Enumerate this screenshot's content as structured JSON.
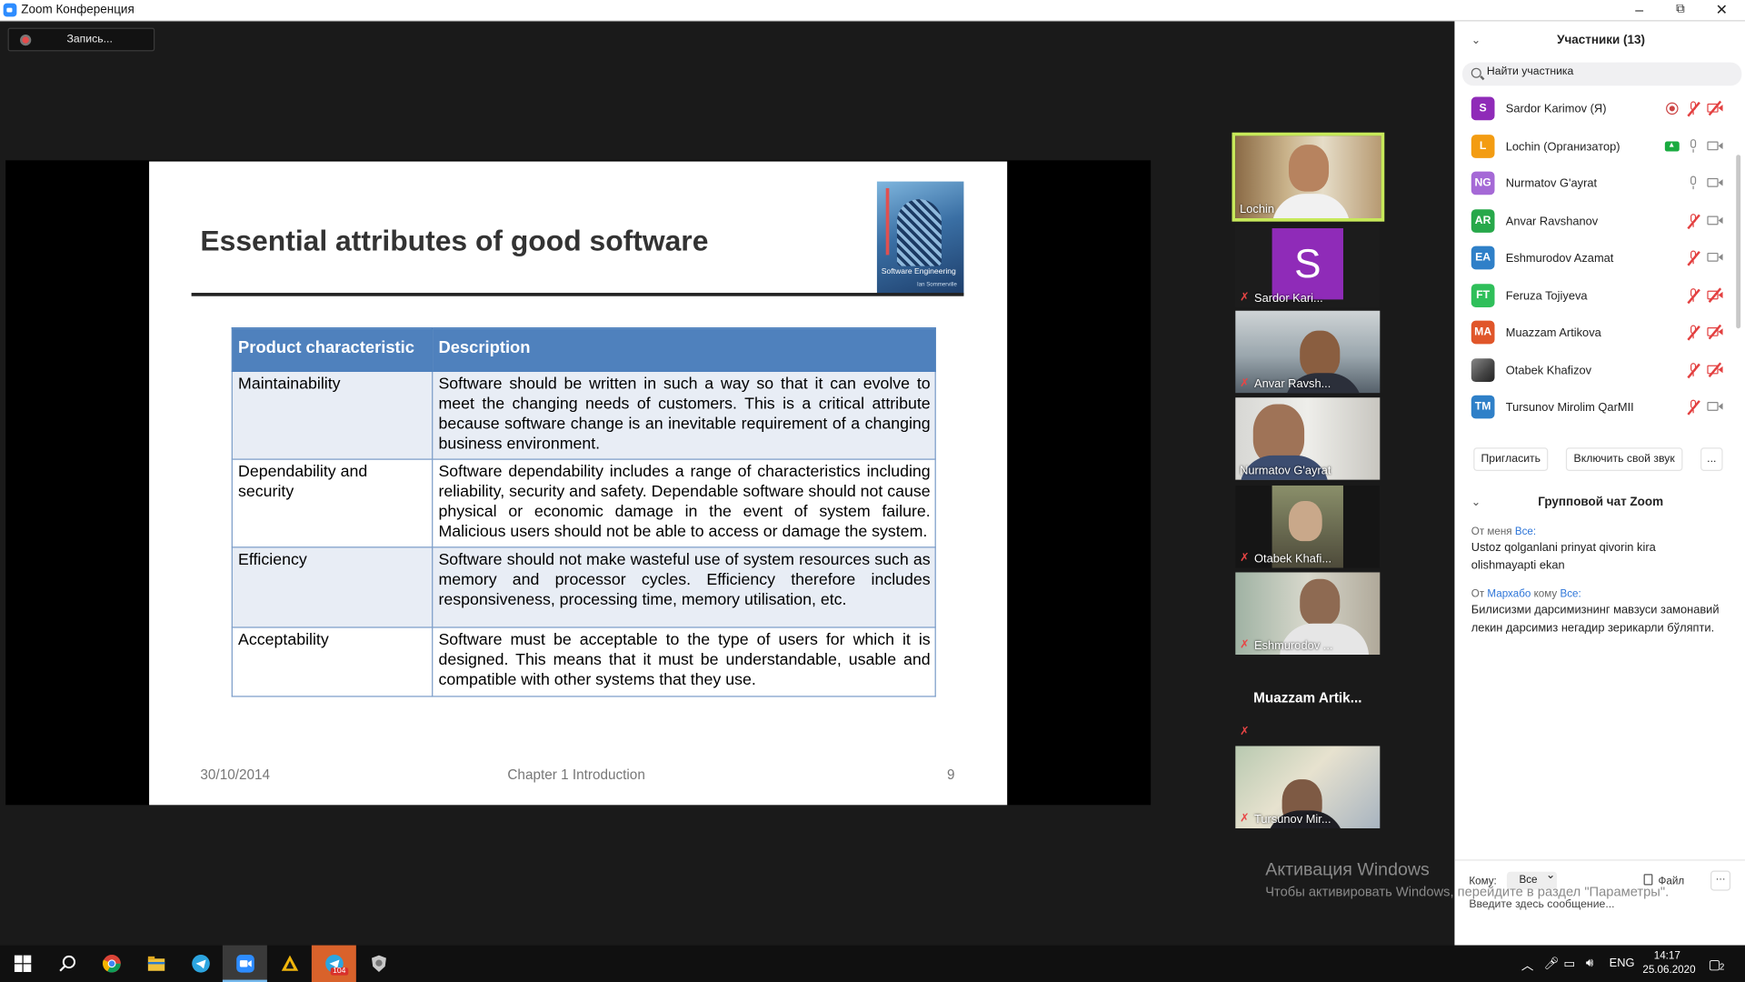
{
  "window": {
    "title": "Zoom Конференция",
    "controls": {
      "minimize": "–",
      "restore": "⧉",
      "close": "✕"
    }
  },
  "recording": {
    "label": "Запись..."
  },
  "slide": {
    "title": "Essential attributes of good software",
    "book": {
      "title": "Software Engineering",
      "author": "Ian Sommerville"
    },
    "table": {
      "headers": [
        "Product characteristic",
        "Description"
      ],
      "rows": [
        {
          "characteristic": "Maintainability",
          "description": "Software should be written in such a way so that it can evolve to meet the changing needs of customers. This is a critical attribute because software change is an inevitable requirement of a changing business environment."
        },
        {
          "characteristic": "Dependability and security",
          "description": "Software dependability includes a range of characteristics including reliability, security and safety. Dependable software should not cause physical or economic damage in the event of system failure. Malicious users should not be  able to access or damage the system."
        },
        {
          "characteristic": "Efficiency",
          "description": "Software should not make wasteful use of system resources such as memory and processor cycles. Efficiency therefore includes responsiveness, processing time, memory utilisation, etc."
        },
        {
          "characteristic": "Acceptability",
          "description": "Software must be acceptable to the type of users for which it is designed. This means that it must be understandable, usable and compatible with other systems that they use."
        }
      ]
    },
    "footer": {
      "date": "30/10/2014",
      "chapter": "Chapter 1 Introduction",
      "page": "9"
    }
  },
  "gallery": [
    {
      "name": "Lochin"
    },
    {
      "name": "Sardor Kari...",
      "initial": "S"
    },
    {
      "name": "Anvar Ravsh..."
    },
    {
      "name": "Nurmatov G'ayrat"
    },
    {
      "name": "Otabek Khafi..."
    },
    {
      "name": "Eshmurodov ..."
    },
    {
      "name": "Muazzam  Artik..."
    },
    {
      "name": "Tursunov Mir..."
    }
  ],
  "watermark": {
    "line1": "Активация Windows",
    "line2": "Чтобы активировать Windows, перейдите в раздел \"Параметры\"."
  },
  "participants": {
    "header": "Участники (13)",
    "search_placeholder": "Найти участника",
    "list": [
      {
        "initials": "S",
        "name": "Sardor Karimov (Я)",
        "color": "#8f2bb8"
      },
      {
        "initials": "L",
        "name": "Lochin (Организатор)",
        "color": "#f39c12"
      },
      {
        "initials": "NG",
        "name": "Nurmatov G'ayrat",
        "color": "#a569d6"
      },
      {
        "initials": "AR",
        "name": "Anvar Ravshanov",
        "color": "#27a84a"
      },
      {
        "initials": "EA",
        "name": "Eshmurodov Azamat",
        "color": "#2f80c8"
      },
      {
        "initials": "FT",
        "name": "Feruza Tojiyeva",
        "color": "#2fbf5a"
      },
      {
        "initials": "MA",
        "name": "Muazzam Artikova",
        "color": "#e0562a"
      },
      {
        "initials": "",
        "name": "Otabek Khafizov",
        "color": "#555555"
      },
      {
        "initials": "TM",
        "name": "Tursunov Mirolim QarMII",
        "color": "#2f80c8"
      }
    ],
    "buttons": {
      "invite": "Пригласить",
      "unmute": "Включить свой звук",
      "more": "..."
    }
  },
  "chat": {
    "header": "Групповой чат Zoom",
    "messages": [
      {
        "meta_prefix": "От меня ",
        "meta_to": "Все:",
        "sender": "",
        "text": "Ustoz qolganlani prinyat qivorin kira olishmayapti ekan"
      },
      {
        "meta_prefix": "От ",
        "sender": "Мархабо",
        "meta_mid": " кому ",
        "meta_to": "Все:",
        "text": "Билисизми дарсимизнинг мавзуси замонавий лекин дарсимиз негадир зерикарли бўляпти."
      }
    ],
    "to_label": "Кому:",
    "to_value": "Все",
    "file_label": "Файл",
    "more": "···",
    "input_placeholder": "Введите здесь сообщение..."
  },
  "taskbar": {
    "telegram_badge": "104",
    "lang": "ENG",
    "time": "14:17",
    "date": "25.06.2020",
    "notifications": "2"
  }
}
